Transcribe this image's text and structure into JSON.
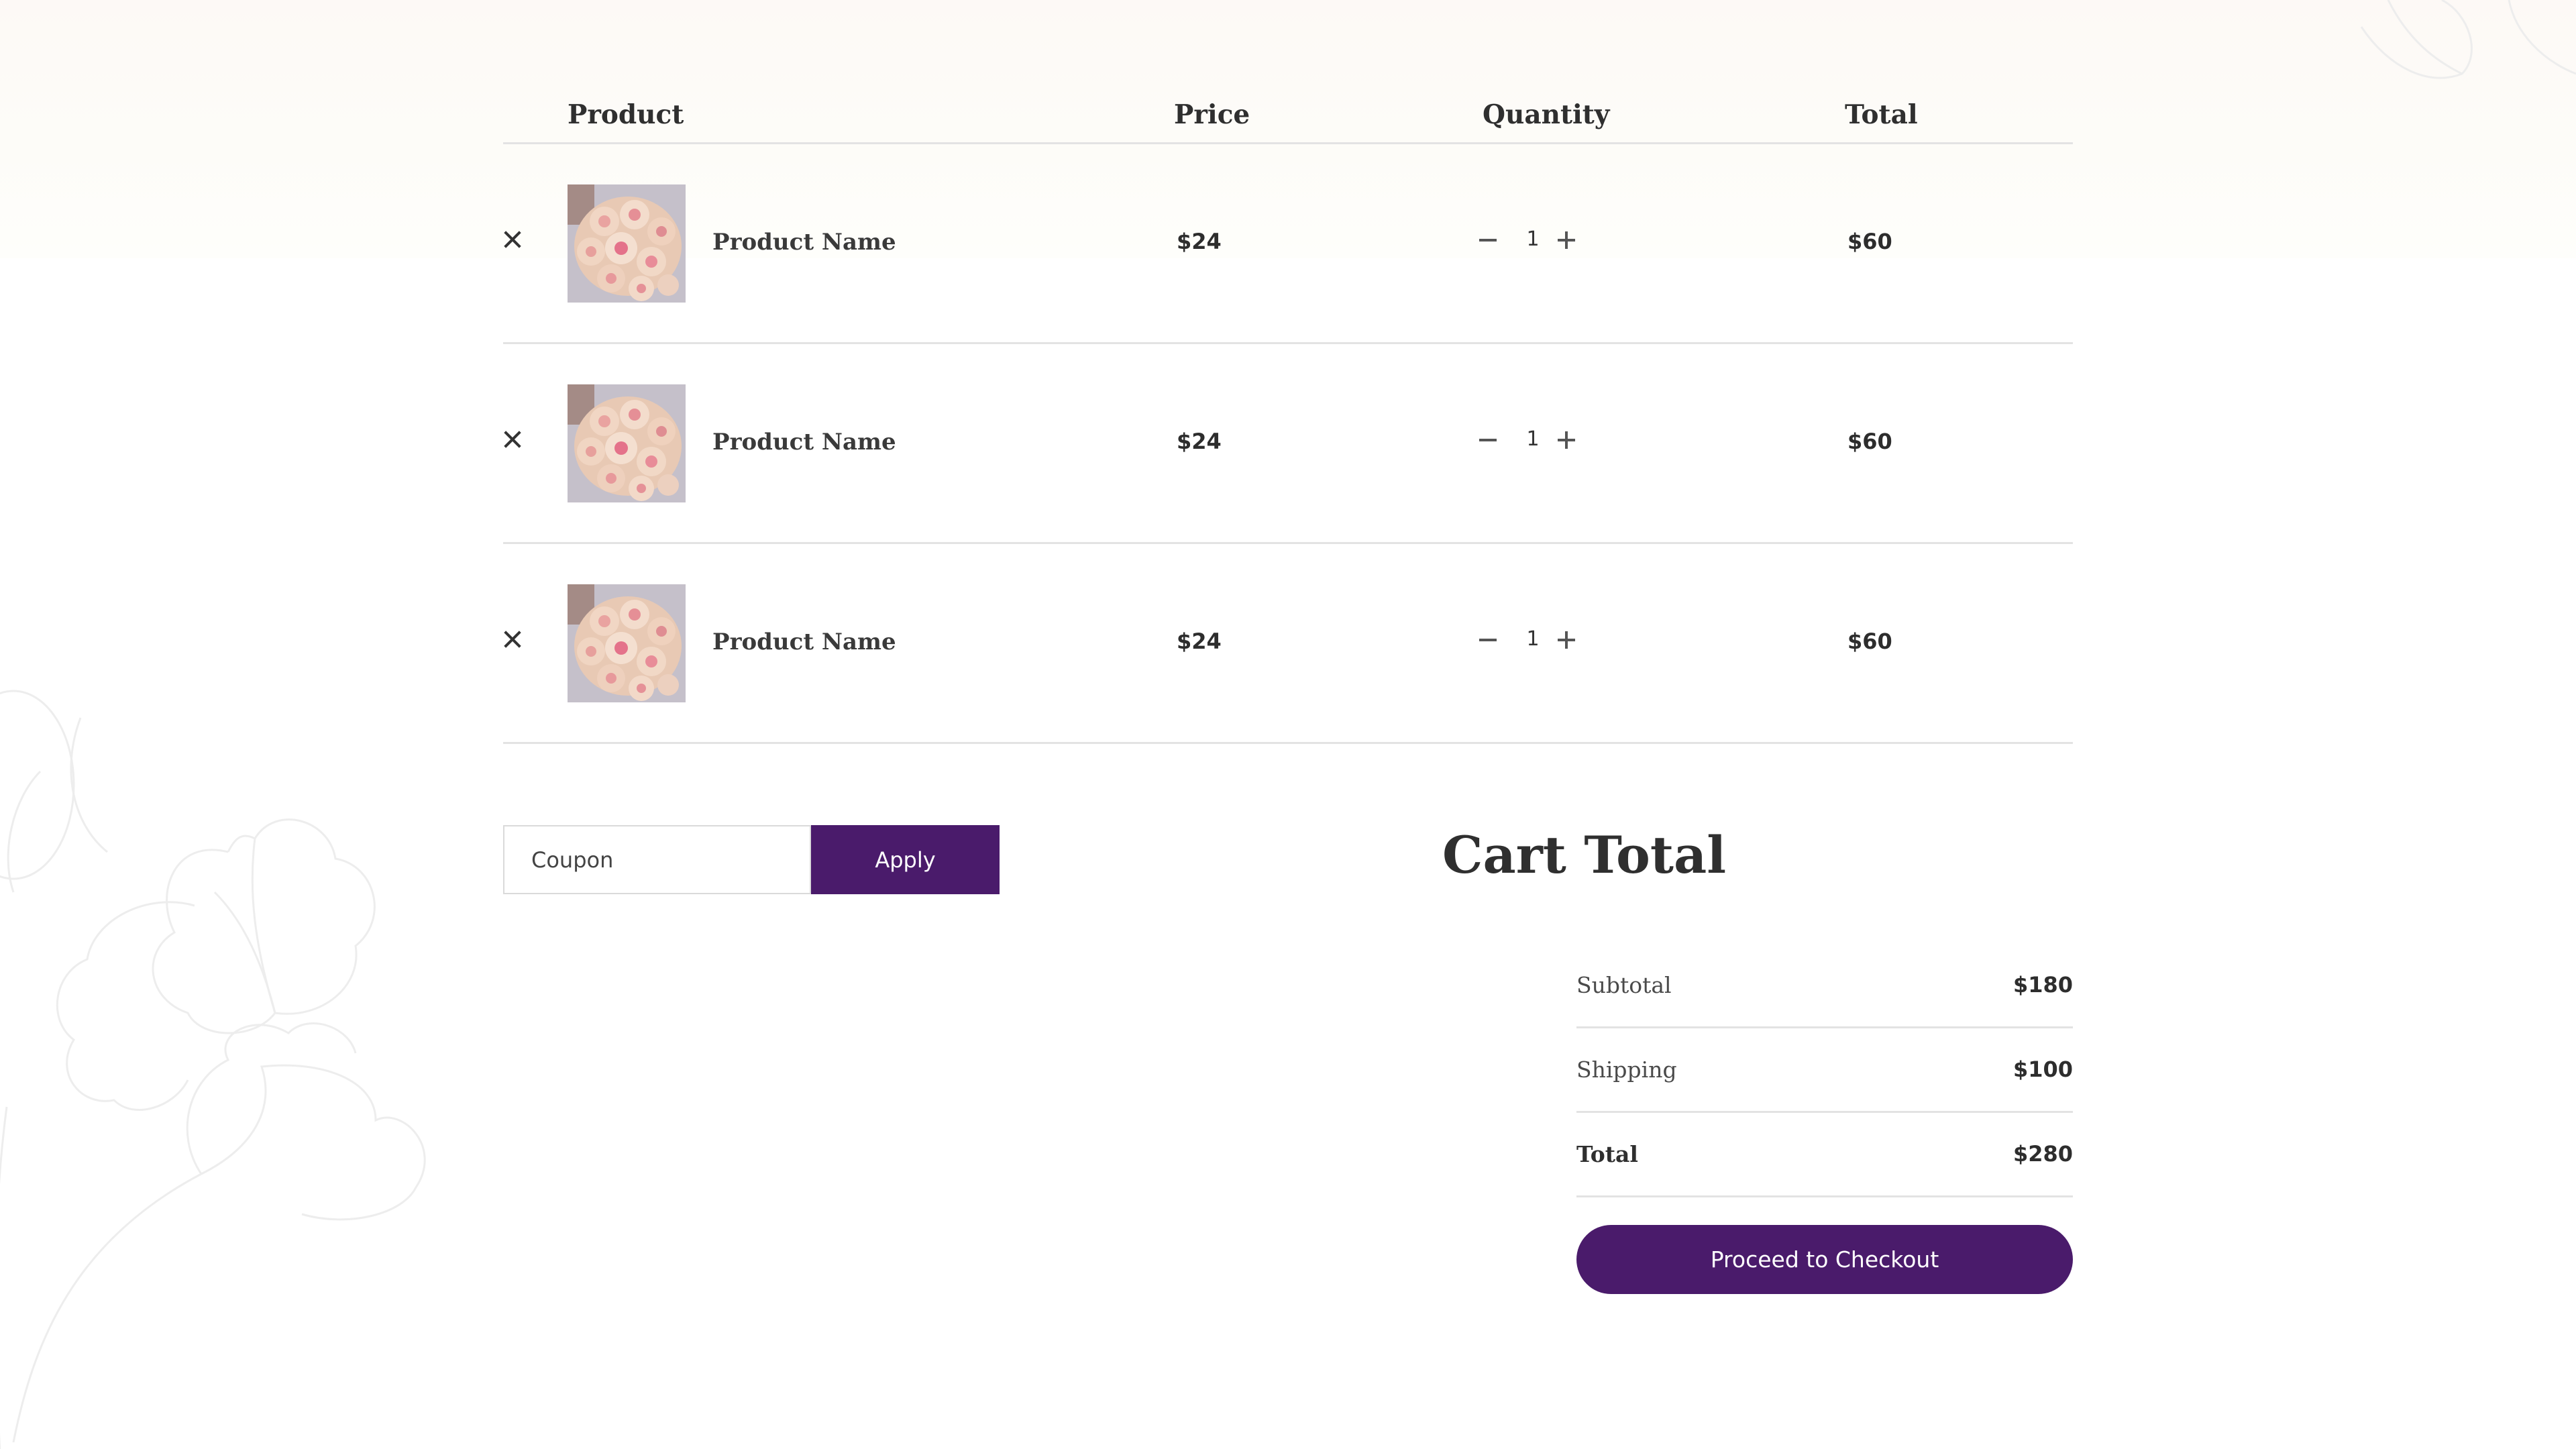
{
  "cart": {
    "columns": {
      "product": "Product",
      "price": "Price",
      "quantity": "Quantity",
      "total": "Total"
    },
    "items": [
      {
        "name": "Product Name",
        "price": "$24",
        "quantity": "1",
        "total": "$60"
      },
      {
        "name": "Product Name",
        "price": "$24",
        "quantity": "1",
        "total": "$60"
      },
      {
        "name": "Product Name",
        "price": "$24",
        "quantity": "1",
        "total": "$60"
      }
    ],
    "icons": {
      "remove": "close-icon",
      "decrement": "minus-icon",
      "increment": "plus-icon"
    }
  },
  "coupon": {
    "placeholder": "Coupon",
    "apply_label": "Apply"
  },
  "summary": {
    "title": "Cart Total",
    "subtotal_label": "Subtotal",
    "subtotal_value": "$180",
    "shipping_label": "Shipping",
    "shipping_value": "$100",
    "total_label": "Total",
    "total_value": "$280",
    "checkout_label": "Proceed to Checkout"
  },
  "colors": {
    "accent": "#4a1b6b",
    "divider": "#e3e3e3",
    "text": "#2b2b2b"
  }
}
